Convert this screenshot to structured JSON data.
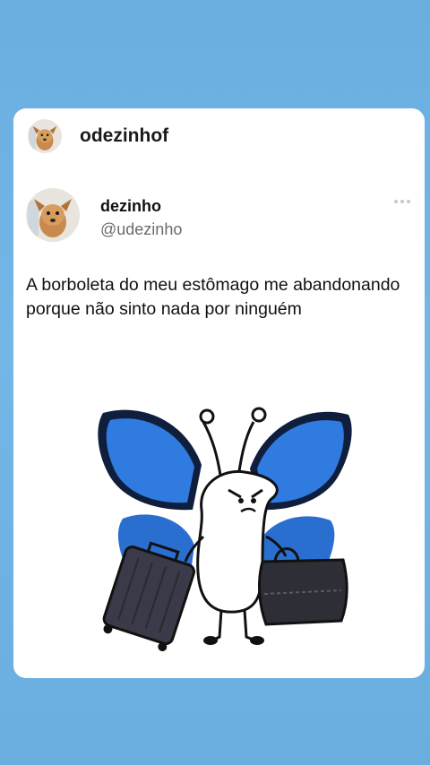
{
  "story": {
    "username": "odezinhof",
    "avatar_icon": "dog-avatar-icon"
  },
  "tweet": {
    "display_name": "dezinho",
    "handle": "@udezinho",
    "text": "A borboleta do meu estômago me abandonando porque não sinto nada por ninguém",
    "more_icon": "more-options-icon",
    "image": "butterfly-character-with-suitcases"
  },
  "colors": {
    "background": "#6aaee0",
    "card": "#ffffff",
    "wing_blue": "#2f7be0",
    "wing_dark": "#0f1e3c"
  }
}
